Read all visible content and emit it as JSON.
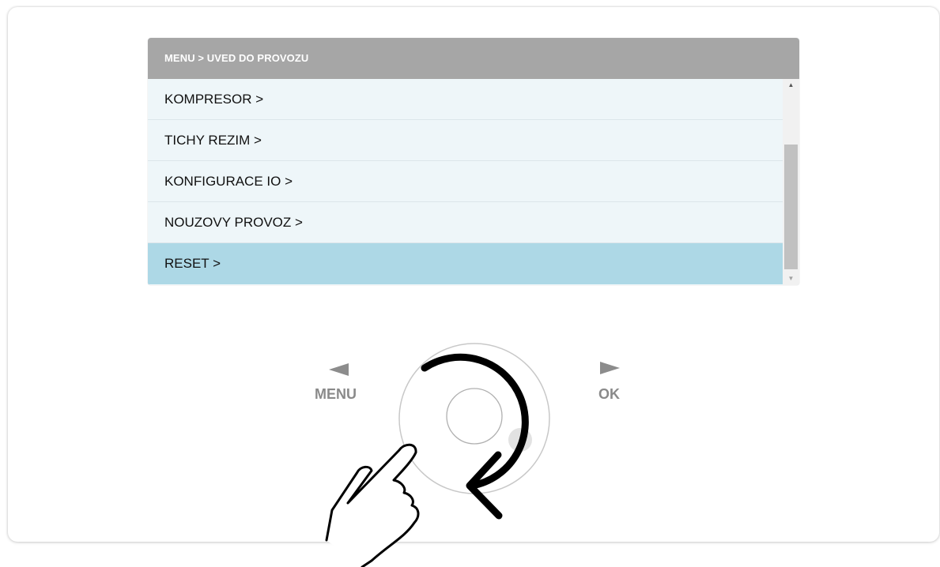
{
  "breadcrumb": "MENU > UVED DO PROVOZU",
  "menu": {
    "items": [
      {
        "label": "KOMPRESOR >"
      },
      {
        "label": "TICHY REZIM >"
      },
      {
        "label": "KONFIGURACE IO >"
      },
      {
        "label": "NOUZOVY PROVOZ >"
      },
      {
        "label": "RESET >",
        "selected": true
      }
    ]
  },
  "controls": {
    "menu_label": "MENU",
    "ok_label": "OK"
  },
  "icons": {
    "scroll_up": "scroll-up-arrow-icon",
    "scroll_down": "scroll-down-arrow-icon",
    "menu_arrow": "triangle-left-icon",
    "ok_arrow": "triangle-right-icon",
    "rotate": "rotate-clockwise-arrow-icon",
    "hand": "pointing-hand-icon"
  },
  "colors": {
    "header_bg": "#a6a6a6",
    "list_bg": "#eef6f9",
    "selected_bg": "#add8e6",
    "control_gray": "#8c8c8c"
  }
}
